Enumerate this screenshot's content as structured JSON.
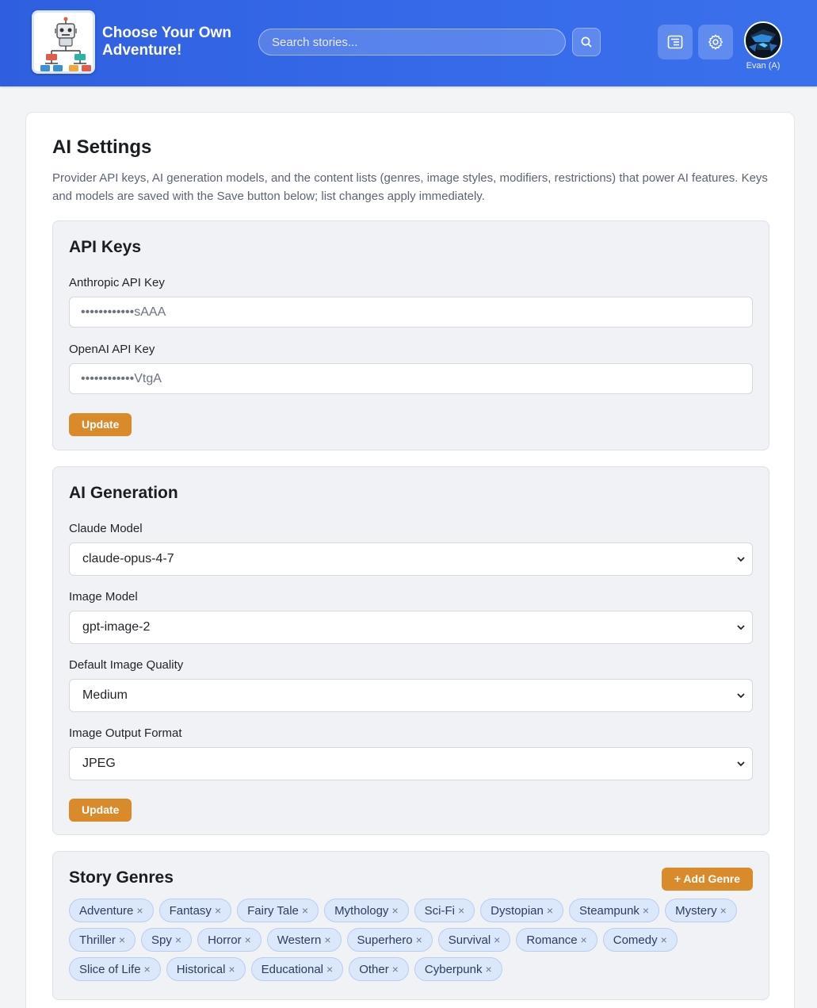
{
  "header": {
    "app_title": "Choose Your Own Adventure!",
    "search_placeholder": "Search stories...",
    "user_name": "Evan (A)"
  },
  "page": {
    "title": "AI Settings",
    "description": "Provider API keys, AI generation models, and the content lists (genres, image styles, modifiers, restrictions) that power AI features. Keys and models are saved with the Save button below; list changes apply immediately."
  },
  "api_keys": {
    "title": "API Keys",
    "anthropic_label": "Anthropic API Key",
    "anthropic_value": "••••••••••••sAAA",
    "openai_label": "OpenAI API Key",
    "openai_value": "••••••••••••VtgA",
    "update_label": "Update"
  },
  "ai_generation": {
    "title": "AI Generation",
    "claude_label": "Claude Model",
    "claude_value": "claude-opus-4-7",
    "image_model_label": "Image Model",
    "image_model_value": "gpt-image-2",
    "quality_label": "Default Image Quality",
    "quality_value": "Medium",
    "format_label": "Image Output Format",
    "format_value": "JPEG",
    "update_label": "Update"
  },
  "genres": {
    "title": "Story Genres",
    "add_label": "+ Add Genre",
    "items": [
      "Adventure",
      "Fantasy",
      "Fairy Tale",
      "Mythology",
      "Sci-Fi",
      "Dystopian",
      "Steampunk",
      "Mystery",
      "Thriller",
      "Spy",
      "Horror",
      "Western",
      "Superhero",
      "Survival",
      "Romance",
      "Comedy",
      "Slice of Life",
      "Historical",
      "Educational",
      "Other",
      "Cyberpunk"
    ],
    "remove_glyph": "×"
  },
  "colors": {
    "header": "#3569e8",
    "accent_button": "#d98a2b",
    "chip_bg": "#dbe7fb"
  },
  "icons": [
    "robot-flowchart-logo",
    "search-icon",
    "list-icon",
    "gear-icon",
    "avatar-image",
    "chevron-down-icon",
    "remove-icon"
  ]
}
